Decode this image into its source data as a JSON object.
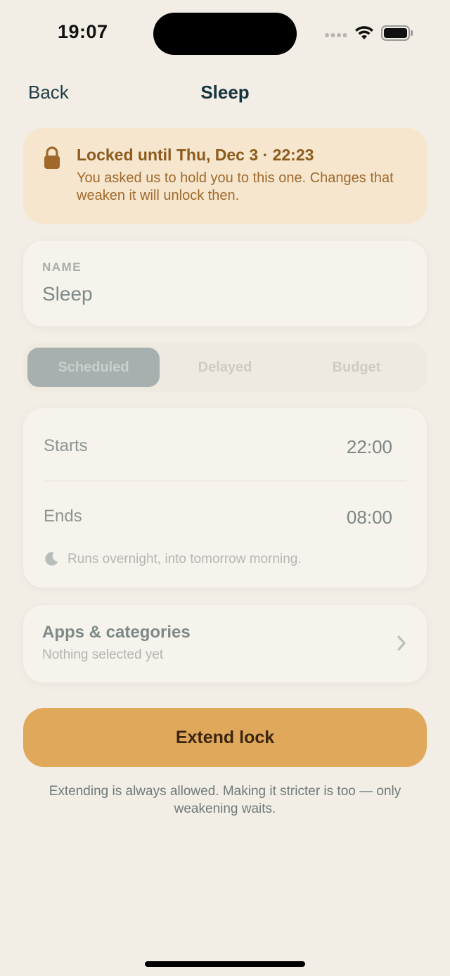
{
  "status_bar": {
    "time": "19:07"
  },
  "nav": {
    "back_label": "Back",
    "title": "Sleep"
  },
  "lock_banner": {
    "title": "Locked until Thu, Dec 3 · 22:23",
    "subtitle": "You asked us to hold you to this one. Changes that weaken it will unlock then.",
    "icon": "lock-icon",
    "color": "#8C5A1C"
  },
  "name_field": {
    "label": "NAME",
    "value": "Sleep"
  },
  "mode_tabs": {
    "selected": "Scheduled",
    "items": [
      "Scheduled",
      "Delayed",
      "Budget"
    ]
  },
  "schedule": {
    "starts_label": "Starts",
    "starts_value": "22:00",
    "ends_label": "Ends",
    "ends_value": "08:00",
    "note": "Runs overnight, into tomorrow morning.",
    "note_icon": "moon-icon"
  },
  "apps": {
    "title": "Apps & categories",
    "subtitle": "Nothing selected yet"
  },
  "extend_button": {
    "label": "Extend lock",
    "color": "#E0A85A"
  },
  "footnote": "Extending is always allowed. Making it stricter is too — only weakening waits."
}
